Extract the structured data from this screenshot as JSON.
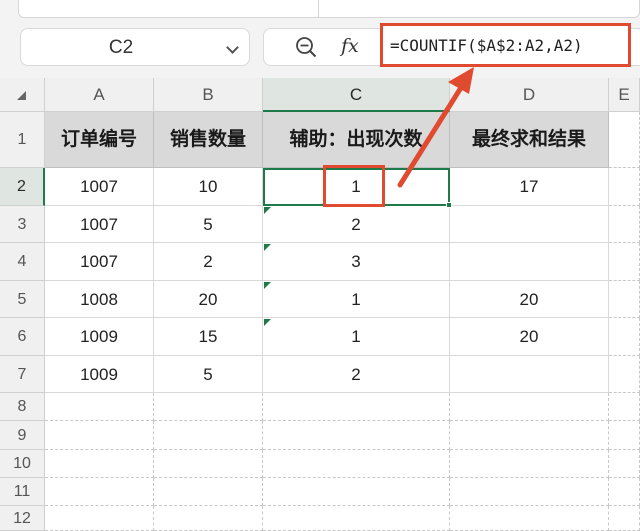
{
  "name_box": {
    "value": "C2"
  },
  "formula_bar": {
    "fx_label": "fx",
    "formula": "=COUNTIF($A$2:A2,A2)"
  },
  "columns": [
    "A",
    "B",
    "C",
    "D",
    "E"
  ],
  "rows": [
    "1",
    "2",
    "3",
    "4",
    "5",
    "6",
    "7",
    "8",
    "9",
    "10",
    "11",
    "12"
  ],
  "headers": {
    "a": "订单编号",
    "b": "销售数量",
    "c": "辅助：出现次数",
    "d": "最终求和结果"
  },
  "data_rows": [
    {
      "a": "1007",
      "b": "10",
      "c": "1",
      "d": "17"
    },
    {
      "a": "1007",
      "b": "5",
      "c": "2",
      "d": ""
    },
    {
      "a": "1007",
      "b": "2",
      "c": "3",
      "d": ""
    },
    {
      "a": "1008",
      "b": "20",
      "c": "1",
      "d": "20"
    },
    {
      "a": "1009",
      "b": "15",
      "c": "1",
      "d": "20"
    },
    {
      "a": "1009",
      "b": "5",
      "c": "2",
      "d": ""
    }
  ],
  "selected_cell": "C2",
  "annotation_color": "#e04a2f",
  "accent_color": "#1e7b49"
}
